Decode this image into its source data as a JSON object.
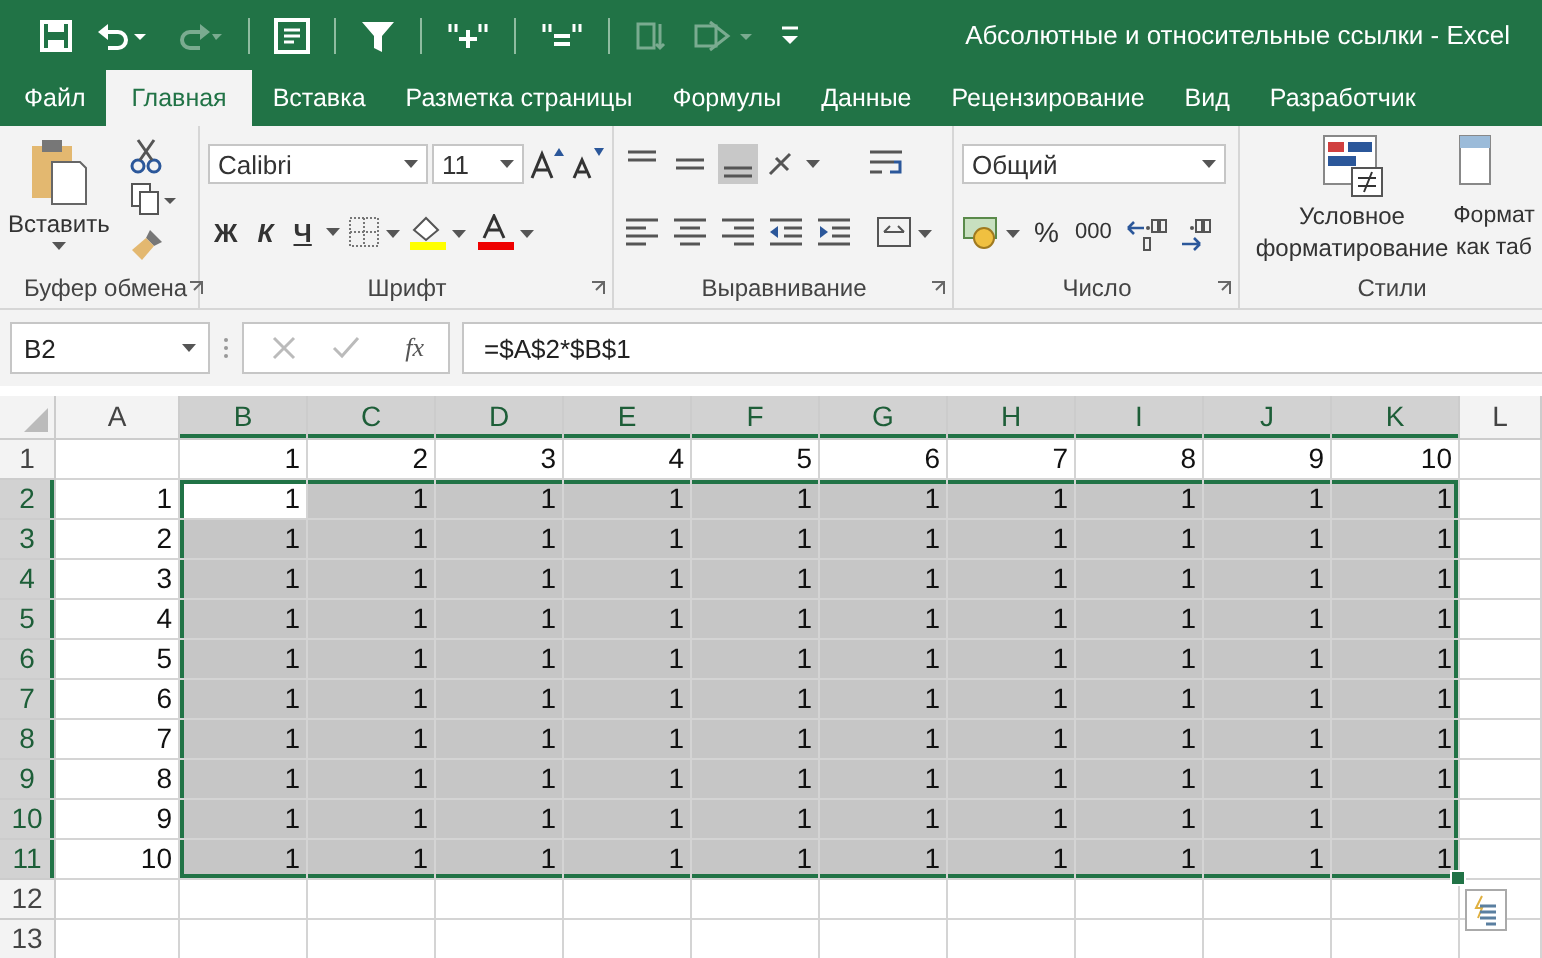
{
  "window": {
    "title": "Абсолютные и относительные ссылки - Excel"
  },
  "quick_access": [
    {
      "kind": "save",
      "disabled": false
    },
    {
      "kind": "undo",
      "disabled": false
    },
    {
      "kind": "redo",
      "disabled": true
    },
    {
      "kind": "form",
      "disabled": false
    },
    {
      "kind": "filter",
      "disabled": false
    },
    {
      "kind": "quote-plus",
      "disabled": false
    },
    {
      "kind": "quote-equals",
      "disabled": false
    },
    {
      "kind": "sort",
      "disabled": true
    },
    {
      "kind": "shape",
      "disabled": true
    },
    {
      "kind": "customize",
      "disabled": false
    }
  ],
  "tabs": [
    {
      "label": "Файл",
      "selected": false
    },
    {
      "label": "Главная",
      "selected": true
    },
    {
      "label": "Вставка",
      "selected": false
    },
    {
      "label": "Разметка страницы",
      "selected": false
    },
    {
      "label": "Формулы",
      "selected": false
    },
    {
      "label": "Данные",
      "selected": false
    },
    {
      "label": "Рецензирование",
      "selected": false
    },
    {
      "label": "Вид",
      "selected": false
    },
    {
      "label": "Разработчик",
      "selected": false
    }
  ],
  "ribbon": {
    "groups": [
      {
        "kind": "clipboard",
        "label": "Буфер обмена",
        "paste_label": "Вставить"
      },
      {
        "kind": "font",
        "label": "Шрифт",
        "font_name": "Calibri",
        "font_size": "11",
        "bold": "Ж",
        "italic": "К",
        "underline": "Ч"
      },
      {
        "kind": "alignment",
        "label": "Выравнивание",
        "bottom_align_selected": true
      },
      {
        "kind": "number",
        "label": "Число",
        "format": "Общий",
        "percent": "%",
        "thousands": "000"
      },
      {
        "kind": "styles",
        "label": "Стили",
        "conditional": "Условное форматирование",
        "table_format": "Формат как таб"
      }
    ]
  },
  "formula_bar": {
    "name_box": "B2",
    "fx": "fx",
    "formula": "=$A$2*$B$1"
  },
  "grid": {
    "columns": [
      {
        "label": "A",
        "selected": false
      },
      {
        "label": "B",
        "selected": true
      },
      {
        "label": "C",
        "selected": true
      },
      {
        "label": "D",
        "selected": true
      },
      {
        "label": "E",
        "selected": true
      },
      {
        "label": "F",
        "selected": true
      },
      {
        "label": "G",
        "selected": true
      },
      {
        "label": "H",
        "selected": true
      },
      {
        "label": "I",
        "selected": true
      },
      {
        "label": "J",
        "selected": true
      },
      {
        "label": "K",
        "selected": true
      },
      {
        "label": "L",
        "selected": false
      }
    ],
    "rows": [
      {
        "header": "1",
        "selected": false,
        "cells": [
          null,
          "1",
          "2",
          "3",
          "4",
          "5",
          "6",
          "7",
          "8",
          "9",
          "10"
        ]
      },
      {
        "header": "2",
        "selected": true,
        "cells": [
          "1",
          {
            "text": "1",
            "active": true
          },
          "1",
          "1",
          "1",
          "1",
          "1",
          "1",
          "1",
          "1",
          "1"
        ]
      },
      {
        "header": "3",
        "selected": true,
        "cells": [
          "2",
          "1",
          "1",
          "1",
          "1",
          "1",
          "1",
          "1",
          "1",
          "1",
          "1"
        ]
      },
      {
        "header": "4",
        "selected": true,
        "cells": [
          "3",
          "1",
          "1",
          "1",
          "1",
          "1",
          "1",
          "1",
          "1",
          "1",
          "1"
        ]
      },
      {
        "header": "5",
        "selected": true,
        "cells": [
          "4",
          "1",
          "1",
          "1",
          "1",
          "1",
          "1",
          "1",
          "1",
          "1",
          "1"
        ]
      },
      {
        "header": "6",
        "selected": true,
        "cells": [
          "5",
          "1",
          "1",
          "1",
          "1",
          "1",
          "1",
          "1",
          "1",
          "1",
          "1"
        ]
      },
      {
        "header": "7",
        "selected": true,
        "cells": [
          "6",
          "1",
          "1",
          "1",
          "1",
          "1",
          "1",
          "1",
          "1",
          "1",
          "1"
        ]
      },
      {
        "header": "8",
        "selected": true,
        "cells": [
          "7",
          "1",
          "1",
          "1",
          "1",
          "1",
          "1",
          "1",
          "1",
          "1",
          "1"
        ]
      },
      {
        "header": "9",
        "selected": true,
        "cells": [
          "8",
          "1",
          "1",
          "1",
          "1",
          "1",
          "1",
          "1",
          "1",
          "1",
          "1"
        ]
      },
      {
        "header": "10",
        "selected": true,
        "cells": [
          "9",
          "1",
          "1",
          "1",
          "1",
          "1",
          "1",
          "1",
          "1",
          "1",
          "1"
        ]
      },
      {
        "header": "11",
        "selected": true,
        "cells": [
          "10",
          "1",
          "1",
          "1",
          "1",
          "1",
          "1",
          "1",
          "1",
          "1",
          "1"
        ]
      },
      {
        "header": "12",
        "selected": false
      },
      {
        "header": "13",
        "selected": false
      }
    ]
  }
}
